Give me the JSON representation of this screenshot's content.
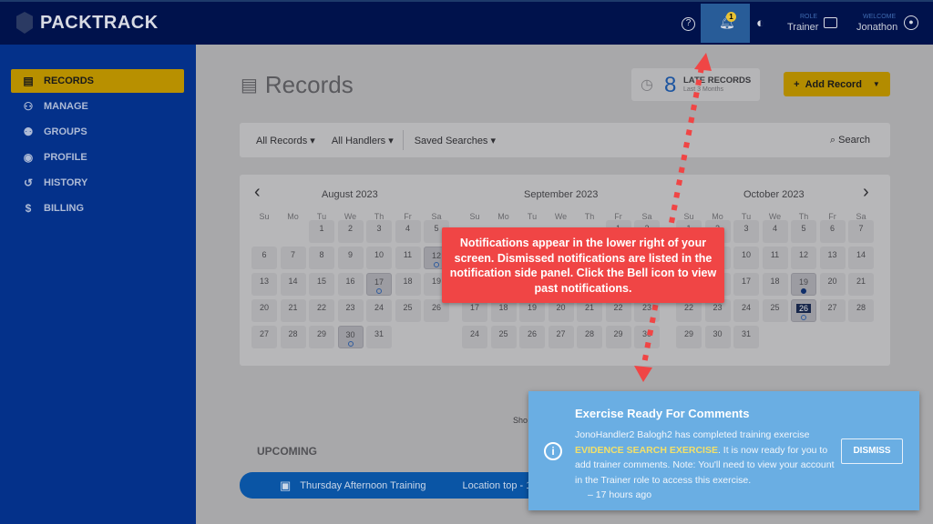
{
  "header": {
    "brand": "PACKTRACK",
    "notification_count": "1",
    "role_label": "ROLE",
    "role_value": "Trainer",
    "welcome_label": "WELCOME",
    "user_name": "Jonathon"
  },
  "sidebar": {
    "items": [
      {
        "label": "RECORDS",
        "icon": "clipboard-icon",
        "active": true
      },
      {
        "label": "MANAGE",
        "icon": "users-icon"
      },
      {
        "label": "GROUPS",
        "icon": "groups-icon"
      },
      {
        "label": "PROFILE",
        "icon": "profile-icon"
      },
      {
        "label": "HISTORY",
        "icon": "history-icon"
      },
      {
        "label": "BILLING",
        "icon": "dollar-icon"
      }
    ]
  },
  "main": {
    "title": "Records",
    "late": {
      "count": "8",
      "label": "LATE RECORDS",
      "sub": "Last 3 Months"
    },
    "add_label": "Add Record",
    "filters": {
      "records": "All Records",
      "handlers": "All Handlers",
      "saved": "Saved Searches",
      "search": "Search"
    },
    "showing_partial": "Sho",
    "upcoming_label": "UPCOMING",
    "upcoming_item": {
      "title": "Thursday Afternoon Training",
      "location": "Location top - 1"
    }
  },
  "calendar": {
    "weekdays": [
      "Su",
      "Mo",
      "Tu",
      "We",
      "Th",
      "Fr",
      "Sa"
    ],
    "months": [
      {
        "name": "August 2023",
        "first_weekday": 2,
        "days": 31,
        "marked": {
          "12": "outline",
          "17": "outline",
          "30": "outline"
        }
      },
      {
        "name": "September 2023",
        "first_weekday": 5,
        "days": 30,
        "marked": {}
      },
      {
        "name": "October 2023",
        "first_weekday": 0,
        "days": 31,
        "marked": {
          "19": "filled",
          "26": "outline"
        },
        "selected": 26
      }
    ]
  },
  "callout": {
    "text": "Notifications appear in the lower right of your screen. Dismissed notifications are listed in the notification side panel. Click the Bell icon to view past notifications.",
    "color": "#f04545"
  },
  "toast": {
    "title": "Exercise Ready For Comments",
    "body_pre": "JonoHandler2 Balogh2 has completed training exercise ",
    "highlight": "EVIDENCE SEARCH EXERCISE",
    "body_post": ". It is now ready for you to add trainer comments. Note: You'll need to view your account in the Trainer role to access this exercise.",
    "time": "– 17 hours ago",
    "dismiss_label": "DISMISS",
    "color": "#6aaee3"
  }
}
